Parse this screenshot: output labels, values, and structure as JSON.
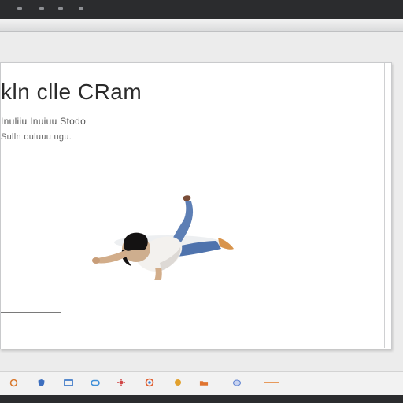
{
  "slide": {
    "heading": "kln clle CRam",
    "subline_1": "Inuliiu Inuiuu Stodo",
    "subline_2": "Sulln ouluuu ugu."
  },
  "taskbar": {
    "icons": [
      {
        "name": "circle-icon",
        "color": "#d9792e"
      },
      {
        "name": "shield-icon",
        "color": "#3d6fbf"
      },
      {
        "name": "window-icon",
        "color": "#2f6fc4"
      },
      {
        "name": "chat-icon",
        "color": "#3f8fd8"
      },
      {
        "name": "settings-icon",
        "color": "#d04545"
      },
      {
        "name": "browser-icon",
        "color": "#e05b2b"
      },
      {
        "name": "dot-icon",
        "color": "#e2a12e"
      },
      {
        "name": "folder-icon",
        "color": "#e0742f"
      },
      {
        "name": "cloud-icon",
        "color": "#5a7fd0"
      },
      {
        "name": "status-icon",
        "color": "#e79a5c"
      }
    ]
  }
}
